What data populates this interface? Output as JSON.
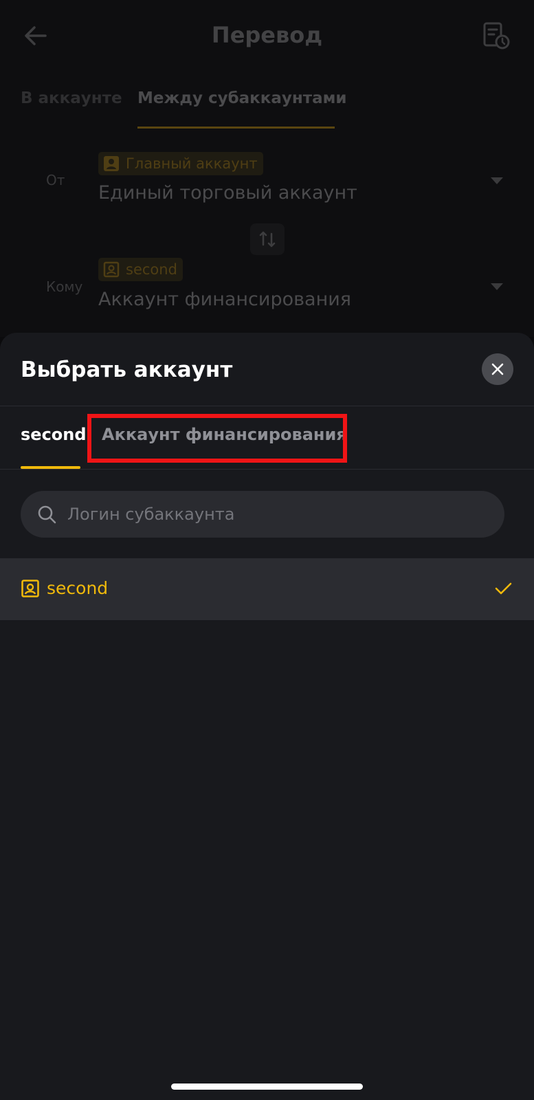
{
  "header": {
    "title": "Перевод",
    "back_icon": "arrow-left-icon",
    "history_icon": "transfer-history-icon"
  },
  "top_tabs": [
    {
      "label": "В аккаунте",
      "active": false
    },
    {
      "label": "Между субаккаунтами",
      "active": true
    }
  ],
  "transfer": {
    "from": {
      "label": "От",
      "badge": "Главный аккаунт",
      "account": "Единый торговый аккаунт"
    },
    "to": {
      "label": "Кому",
      "badge": "second",
      "account": "Аккаунт финансирования"
    },
    "swap_icon": "swap-arrows-icon"
  },
  "sheet": {
    "title": "Выбрать аккаунт",
    "close_icon": "close-icon",
    "tabs": [
      {
        "label": "second",
        "active": true
      },
      {
        "label": "Аккаунт финансирования",
        "active": false
      }
    ],
    "search": {
      "placeholder": "Логин субаккаунта",
      "value": ""
    },
    "items": [
      {
        "label": "second",
        "selected": true
      }
    ]
  },
  "colors": {
    "accent": "#f0b90b",
    "highlight": "#f01416",
    "sheet_bg": "#18191d",
    "row_selected_bg": "#2b2c31"
  }
}
